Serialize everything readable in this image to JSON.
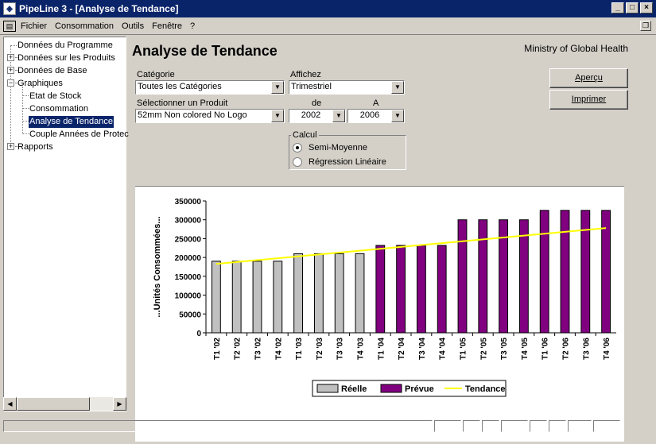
{
  "window": {
    "title": "PipeLine 3 - [Analyse de Tendance]",
    "icon": "app-icon",
    "min": "_",
    "max": "□",
    "close": "×"
  },
  "menu": {
    "items": [
      "Fichier",
      "Consommation",
      "Outils",
      "Fenêtre",
      "?"
    ]
  },
  "tree": {
    "items": [
      {
        "label": "Données du Programme"
      },
      {
        "label": "Données sur les Produits"
      },
      {
        "label": "Données de Base"
      },
      {
        "label": "Graphiques"
      },
      {
        "label": "Etat de Stock"
      },
      {
        "label": "Consommation"
      },
      {
        "label": "Analyse de Tendance"
      },
      {
        "label": "Couple Années de Protec"
      },
      {
        "label": "Rapports"
      }
    ]
  },
  "page": {
    "title": "Analyse de Tendance",
    "org": "Ministry of Global Health"
  },
  "filters": {
    "category_label": "Catégorie",
    "category_value": "Toutes les Catégories",
    "display_label": "Affichez",
    "display_value": "Trimestriel",
    "product_label": "Sélectionner un Produit",
    "product_value": "52mm Non colored No Logo",
    "from_label": "de",
    "from_value": "2002",
    "to_label": "A",
    "to_value": "2006"
  },
  "calc": {
    "label": "Calcul",
    "option1": "Semi-Moyenne",
    "option2": "Régression Linéaire",
    "selected": "Semi-Moyenne"
  },
  "buttons": {
    "preview": "Aperçu",
    "print": "Imprimer"
  },
  "chart_data": {
    "type": "bar",
    "ylabel": "...Unités Consommées...",
    "ylim": [
      0,
      350000
    ],
    "yticks": [
      "0",
      "50000",
      "100000",
      "150000",
      "200000",
      "250000",
      "300000",
      "350000"
    ],
    "categories": [
      "T1 '02",
      "T2 '02",
      "T3 '02",
      "T4 '02",
      "T1 '03",
      "T2 '03",
      "T3 '03",
      "T4 '03",
      "T1 '04",
      "T2 '04",
      "T3 '04",
      "T4 '04",
      "T1 '05",
      "T2 '05",
      "T3 '05",
      "T4 '05",
      "T1 '06",
      "T2 '06",
      "T3 '06",
      "T4 '06"
    ],
    "series": [
      {
        "name": "Réelle",
        "color": "#c0c0c0",
        "values": [
          190000,
          190000,
          190000,
          190000,
          210000,
          210000,
          210000,
          210000,
          null,
          null,
          null,
          null,
          null,
          null,
          null,
          null,
          null,
          null,
          null,
          null
        ]
      },
      {
        "name": "Prévue",
        "color": "#800080",
        "values": [
          null,
          null,
          null,
          null,
          null,
          null,
          null,
          null,
          232000,
          232000,
          232000,
          232000,
          300000,
          300000,
          300000,
          300000,
          325000,
          325000,
          325000,
          325000
        ]
      },
      {
        "name": "Tendance",
        "color": "#ffff00",
        "type": "line",
        "values": [
          183000,
          188000,
          193000,
          198000,
          203000,
          208000,
          213000,
          218000,
          223000,
          228000,
          233000,
          238000,
          243000,
          248000,
          253000,
          258000,
          263000,
          268000,
          273000,
          278000
        ]
      }
    ],
    "legend": [
      "Réelle",
      "Prévue",
      "Tendance"
    ],
    "legend_position": "bottom"
  }
}
